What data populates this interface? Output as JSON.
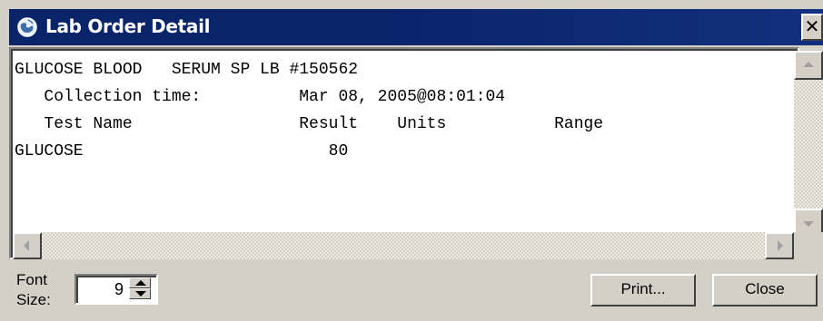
{
  "window": {
    "title": "Lab Order Detail",
    "close_glyph": "✕",
    "icon": "globe-icon"
  },
  "report": {
    "lines": [
      "GLUCOSE BLOOD   SERUM SP LB #150562",
      "",
      "   Collection time:          Mar 08, 2005@08:01:04",
      "   Test Name                 Result    Units           Range",
      "GLUCOSE                         80",
      ""
    ]
  },
  "footer": {
    "font_label_line1": "Font",
    "font_label_line2": "Size:",
    "font_size": "9",
    "print_label": "Print...",
    "close_label": "Close"
  },
  "colors": {
    "title_bar": "#0a246a",
    "face": "#d4d0c8"
  }
}
